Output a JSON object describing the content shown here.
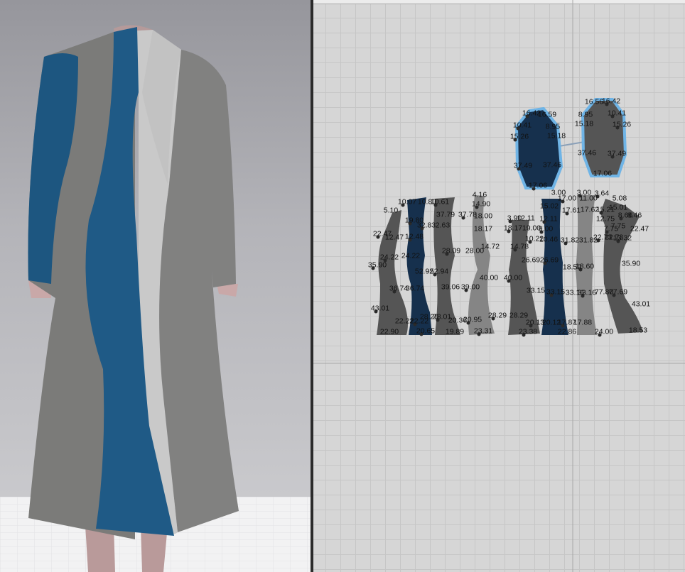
{
  "viewport_3d": {
    "label": "3D Garment View"
  },
  "viewport_2d": {
    "label": "2D Pattern View"
  },
  "colors": {
    "blue_fabric": "#1f5a86",
    "grey_fabric": "#7a7a78",
    "white_fabric": "#c8c8c8",
    "selection": "#6fb4e6",
    "pattern_dark": "#545454",
    "pattern_light": "#858585",
    "pattern_blue": "#16304d"
  },
  "sleeve_labels": [
    "16.42",
    "16.59",
    "10.41",
    "8.95",
    "15.26",
    "15.18",
    "37.49",
    "37.46",
    "17.06",
    "16.56",
    "16.42",
    "8.95",
    "10.41",
    "15.18",
    "15.26",
    "37.46",
    "37.49",
    "17.06"
  ],
  "panel_labels": [
    "10.07",
    "10.80",
    "10.61",
    "4.16",
    "14.90",
    "5.10",
    "19.80",
    "37.79",
    "37.78",
    "18.00",
    "32.83",
    "2.63",
    "22.47",
    "12.47",
    "12.48",
    "18.17",
    "28.09",
    "28.00",
    "24.22",
    "24.22",
    "35.90",
    "52.92",
    "52.94",
    "39.06",
    "39.00",
    "40.00",
    "36.74",
    "36.74",
    "43.01",
    "28.20",
    "28.01",
    "20.36",
    "20.95",
    "22.22",
    "22.22",
    "22.90",
    "20.65",
    "19.89",
    "23.31",
    "3.00",
    "17.00",
    "15.02",
    "3.00",
    "11.00",
    "3.64",
    "5.08",
    "17.61",
    "17.62",
    "15.21",
    "15.01",
    "3.90",
    "12.11",
    "12.11",
    "12.75",
    "8.66",
    "8.46",
    "18.17",
    "19.00",
    "9.00",
    "7.75",
    "7.75",
    "22.47",
    "10.22",
    "10.46",
    "31.82",
    "31.82",
    "22.73",
    "22.73",
    "13.32",
    "14.72",
    "14.78",
    "26.69",
    "26.69",
    "18.59",
    "18.60",
    "35.90",
    "40.00",
    "33.15",
    "33.15",
    "33.16",
    "33.16",
    "77.80",
    "77.69",
    "43.01",
    "28.29",
    "28.29",
    "20.13",
    "20.12",
    "17.87",
    "17.88",
    "23.38",
    "22.86",
    "24.00",
    "18.53"
  ]
}
